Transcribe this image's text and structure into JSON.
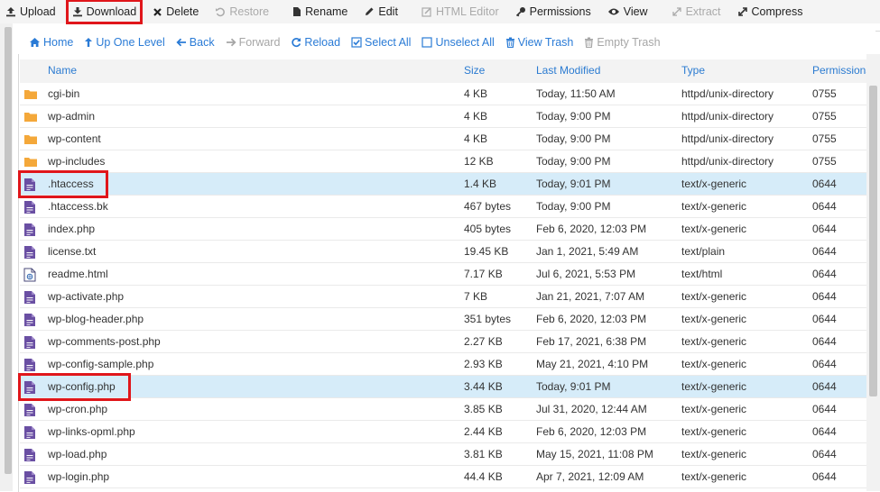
{
  "toolbar": [
    {
      "label": "Upload",
      "icon": "upload-icon",
      "disabled": false,
      "highlighted": false
    },
    {
      "label": "Download",
      "icon": "download-icon",
      "disabled": false,
      "highlighted": true
    },
    {
      "label": "Delete",
      "icon": "delete-icon",
      "disabled": false,
      "highlighted": false
    },
    {
      "label": "Restore",
      "icon": "restore-icon",
      "disabled": true,
      "highlighted": false
    },
    {
      "label": "Rename",
      "icon": "rename-icon",
      "disabled": false,
      "highlighted": false
    },
    {
      "label": "Edit",
      "icon": "edit-icon",
      "disabled": false,
      "highlighted": false
    },
    {
      "label": "HTML Editor",
      "icon": "html-editor-icon",
      "disabled": true,
      "highlighted": false
    },
    {
      "label": "Permissions",
      "icon": "key-icon",
      "disabled": false,
      "highlighted": false
    },
    {
      "label": "View",
      "icon": "eye-icon",
      "disabled": false,
      "highlighted": false
    },
    {
      "label": "Extract",
      "icon": "extract-icon",
      "disabled": true,
      "highlighted": false
    },
    {
      "label": "Compress",
      "icon": "compress-icon",
      "disabled": false,
      "highlighted": false
    }
  ],
  "nav": [
    {
      "label": "Home",
      "icon": "home-icon",
      "disabled": false
    },
    {
      "label": "Up One Level",
      "icon": "level-up-icon",
      "disabled": false
    },
    {
      "label": "Back",
      "icon": "back-arrow-icon",
      "disabled": false
    },
    {
      "label": "Forward",
      "icon": "forward-arrow-icon",
      "disabled": true
    },
    {
      "label": "Reload",
      "icon": "reload-icon",
      "disabled": false
    },
    {
      "label": "Select All",
      "icon": "checkbox-checked-icon",
      "disabled": false
    },
    {
      "label": "Unselect All",
      "icon": "checkbox-empty-icon",
      "disabled": false
    },
    {
      "label": "View Trash",
      "icon": "trash-icon",
      "disabled": false
    },
    {
      "label": "Empty Trash",
      "icon": "trash-icon",
      "disabled": true
    }
  ],
  "columns": {
    "name": "Name",
    "size": "Size",
    "modified": "Last Modified",
    "type": "Type",
    "perms": "Permissions"
  },
  "files": [
    {
      "icon": "folder",
      "name": "cgi-bin",
      "size": "4 KB",
      "modified": "Today, 11:50 AM",
      "type": "httpd/unix-directory",
      "perms": "0755",
      "selected": false,
      "highlighted": false
    },
    {
      "icon": "folder",
      "name": "wp-admin",
      "size": "4 KB",
      "modified": "Today, 9:00 PM",
      "type": "httpd/unix-directory",
      "perms": "0755",
      "selected": false,
      "highlighted": false
    },
    {
      "icon": "folder",
      "name": "wp-content",
      "size": "4 KB",
      "modified": "Today, 9:00 PM",
      "type": "httpd/unix-directory",
      "perms": "0755",
      "selected": false,
      "highlighted": false
    },
    {
      "icon": "folder",
      "name": "wp-includes",
      "size": "12 KB",
      "modified": "Today, 9:00 PM",
      "type": "httpd/unix-directory",
      "perms": "0755",
      "selected": false,
      "highlighted": false
    },
    {
      "icon": "file",
      "name": ".htaccess",
      "size": "1.4 KB",
      "modified": "Today, 9:01 PM",
      "type": "text/x-generic",
      "perms": "0644",
      "selected": true,
      "highlighted": true
    },
    {
      "icon": "file",
      "name": ".htaccess.bk",
      "size": "467 bytes",
      "modified": "Today, 9:00 PM",
      "type": "text/x-generic",
      "perms": "0644",
      "selected": false,
      "highlighted": false
    },
    {
      "icon": "file",
      "name": "index.php",
      "size": "405 bytes",
      "modified": "Feb 6, 2020, 12:03 PM",
      "type": "text/x-generic",
      "perms": "0644",
      "selected": false,
      "highlighted": false
    },
    {
      "icon": "file",
      "name": "license.txt",
      "size": "19.45 KB",
      "modified": "Jan 1, 2021, 5:49 AM",
      "type": "text/plain",
      "perms": "0644",
      "selected": false,
      "highlighted": false
    },
    {
      "icon": "html",
      "name": "readme.html",
      "size": "7.17 KB",
      "modified": "Jul 6, 2021, 5:53 PM",
      "type": "text/html",
      "perms": "0644",
      "selected": false,
      "highlighted": false
    },
    {
      "icon": "file",
      "name": "wp-activate.php",
      "size": "7 KB",
      "modified": "Jan 21, 2021, 7:07 AM",
      "type": "text/x-generic",
      "perms": "0644",
      "selected": false,
      "highlighted": false
    },
    {
      "icon": "file",
      "name": "wp-blog-header.php",
      "size": "351 bytes",
      "modified": "Feb 6, 2020, 12:03 PM",
      "type": "text/x-generic",
      "perms": "0644",
      "selected": false,
      "highlighted": false
    },
    {
      "icon": "file",
      "name": "wp-comments-post.php",
      "size": "2.27 KB",
      "modified": "Feb 17, 2021, 6:38 PM",
      "type": "text/x-generic",
      "perms": "0644",
      "selected": false,
      "highlighted": false
    },
    {
      "icon": "file",
      "name": "wp-config-sample.php",
      "size": "2.93 KB",
      "modified": "May 21, 2021, 4:10 PM",
      "type": "text/x-generic",
      "perms": "0644",
      "selected": false,
      "highlighted": false
    },
    {
      "icon": "file",
      "name": "wp-config.php",
      "size": "3.44 KB",
      "modified": "Today, 9:01 PM",
      "type": "text/x-generic",
      "perms": "0644",
      "selected": true,
      "highlighted": true
    },
    {
      "icon": "file",
      "name": "wp-cron.php",
      "size": "3.85 KB",
      "modified": "Jul 31, 2020, 12:44 AM",
      "type": "text/x-generic",
      "perms": "0644",
      "selected": false,
      "highlighted": false
    },
    {
      "icon": "file",
      "name": "wp-links-opml.php",
      "size": "2.44 KB",
      "modified": "Feb 6, 2020, 12:03 PM",
      "type": "text/x-generic",
      "perms": "0644",
      "selected": false,
      "highlighted": false
    },
    {
      "icon": "file",
      "name": "wp-load.php",
      "size": "3.81 KB",
      "modified": "May 15, 2021, 11:08 PM",
      "type": "text/x-generic",
      "perms": "0644",
      "selected": false,
      "highlighted": false
    },
    {
      "icon": "file",
      "name": "wp-login.php",
      "size": "44.4 KB",
      "modified": "Apr 7, 2021, 12:09 AM",
      "type": "text/x-generic",
      "perms": "0644",
      "selected": false,
      "highlighted": false
    }
  ],
  "colors": {
    "accent": "#2b7bd1",
    "highlight_box": "#e0161b",
    "selected_row": "#d6ecf9",
    "folder": "#f4a83a",
    "file": "#6a4fa3"
  }
}
